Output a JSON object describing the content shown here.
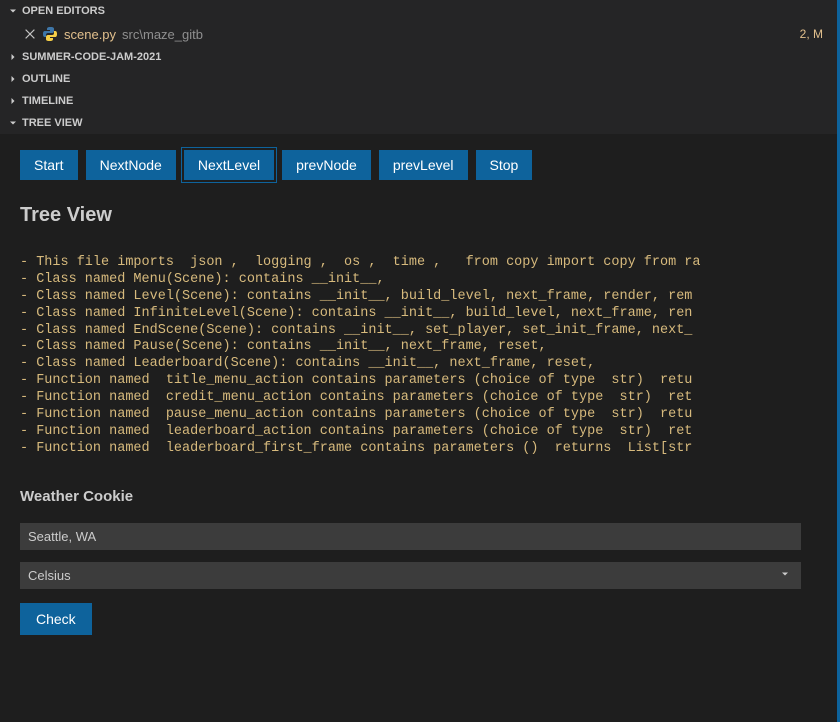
{
  "sections": {
    "open_editors": "OPEN EDITORS",
    "summer": "SUMMER-CODE-JAM-2021",
    "outline": "OUTLINE",
    "timeline": "TIMELINE",
    "tree_view": "TREE VIEW"
  },
  "open_file": {
    "name": "scene.py",
    "path": "src\\maze_gitb",
    "status": "2, M"
  },
  "tree": {
    "buttons": {
      "start": "Start",
      "next_node": "NextNode",
      "next_level": "NextLevel",
      "prev_node": "prevNode",
      "prev_level": "prevLevel",
      "stop": "Stop"
    },
    "title": "Tree View",
    "lines": [
      "- This file imports  json ,  logging ,  os ,  time ,   from copy import copy from ra",
      "- Class named Menu(Scene): contains __init__,",
      "- Class named Level(Scene): contains __init__, build_level, next_frame, render, rem",
      "- Class named InfiniteLevel(Scene): contains __init__, build_level, next_frame, ren",
      "- Class named EndScene(Scene): contains __init__, set_player, set_init_frame, next_",
      "- Class named Pause(Scene): contains __init__, next_frame, reset,",
      "- Class named Leaderboard(Scene): contains __init__, next_frame, reset,",
      "- Function named  title_menu_action contains parameters (choice of type  str)  retu",
      "- Function named  credit_menu_action contains parameters (choice of type  str)  ret",
      "- Function named  pause_menu_action contains parameters (choice of type  str)  retu",
      "- Function named  leaderboard_action contains parameters (choice of type  str)  ret",
      "- Function named  leaderboard_first_frame contains parameters ()  returns  List[str"
    ]
  },
  "weather": {
    "title": "Weather Cookie",
    "location": "Seattle, WA",
    "unit": "Celsius",
    "check": "Check"
  }
}
